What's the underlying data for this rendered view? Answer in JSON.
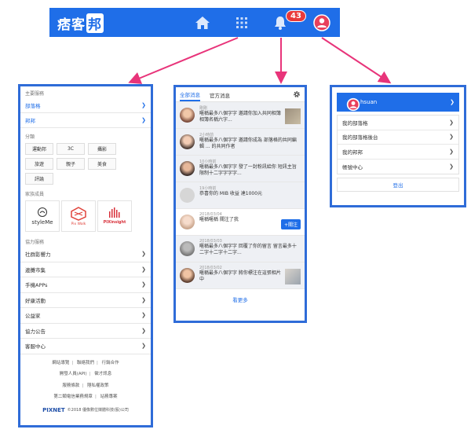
{
  "topbar": {
    "logo_text": "痞客",
    "logo_box_text": "邦",
    "notification_count": "43",
    "icons": [
      "home-icon",
      "apps-grid-icon",
      "bell-icon",
      "avatar-icon"
    ],
    "bar_color": "#1f6ee8"
  },
  "menu": {
    "main_services_title": "主要服務",
    "main_services": [
      {
        "label": "部落格"
      },
      {
        "label": "邦邦"
      }
    ],
    "categories_title": "分類",
    "categories": [
      "運動邦",
      "3C",
      "攝影",
      "旅遊",
      "親子",
      "美食",
      "評論"
    ],
    "members_title": "家族成員",
    "members": [
      "styleMe",
      "Pix Walk",
      "PIXinsight"
    ],
    "helper_title": "協力服務",
    "helper_items": [
      "社群影響力",
      "邊攤市集",
      "手機APPs",
      "好康活動",
      "公益家",
      "協力公告",
      "客服中心"
    ],
    "footer_links": [
      [
        "網站導覽",
        "聯絡我們",
        "行銷合作"
      ],
      [
        "開發人員(API)",
        "徵才訊息"
      ],
      [
        "服務條款",
        "隱私權政策"
      ],
      [
        "第二類電信業務規章",
        "站務專案"
      ]
    ],
    "brand": "PIXNET",
    "copyright": "©2018 優像數位媒體科技(股)公司"
  },
  "notifications": {
    "tabs": [
      "全部消息",
      "官方消息"
    ],
    "items": [
      {
        "time": "剛剛",
        "text": "暱稱最多八個字字 邀請你加入共同相簿 相簿名稱六字..."
      },
      {
        "time": "2小時前",
        "text": "暱稱最多八個字字 邀請你成為 部落格的共同編輯 ... 的共同作者"
      },
      {
        "time": "10小時前",
        "text": "暱稱最多八個字字 發了一封粉訊給你 短訊主旨限制十二字字字字..."
      },
      {
        "time": "19小時前",
        "text": "恭喜你的 MIB 收益 達1000元"
      },
      {
        "time": "2018/03/04",
        "text": "暱稱暱稱 關注了我",
        "action": "+關注"
      },
      {
        "time": "2018/03/03",
        "text": "暱稱最多八個字字 回覆了你的留言 留言最多十二字十二字十二字..."
      },
      {
        "time": "2018/03/02",
        "text": "暱稱最多八個字字 將你標注在這張相片中"
      }
    ],
    "see_more": "看更多"
  },
  "user_menu": {
    "username": "hsuan",
    "items": [
      "我的部落格",
      "我的部落格後台",
      "我的邦邦",
      "帳號中心"
    ],
    "logout": "登出"
  }
}
